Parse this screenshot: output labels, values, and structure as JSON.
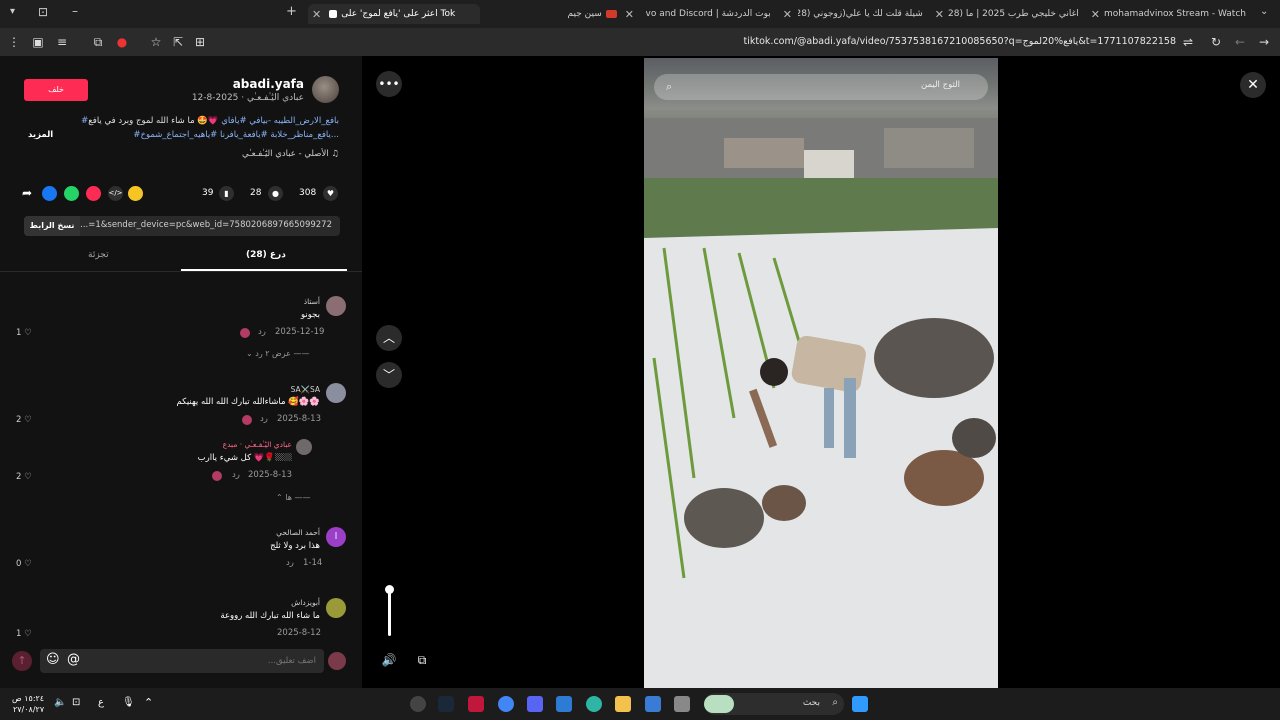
{
  "browser": {
    "tabs": [
      {
        "label": "mohamadvinox Stream - Watch",
        "favicon_color": "#53fc18"
      },
      {
        "label": "(28) اغاني خليجي طرب 2025 | ما",
        "favicon_color": "#ff0033"
      },
      {
        "label": "(28) شيلة قلت لك يا علي(زوجوني",
        "favicon_color": "#ff0033"
      },
      {
        "label": "rovo and Discord | بوت الدردشة",
        "favicon_color": "#ffffff"
      },
      {
        "label": "سين جيم",
        "favicon_color": "#d23a2a"
      },
      {
        "label": "اعثر على 'يافع لموج' على Tok",
        "favicon_color": "#ffffff"
      }
    ],
    "url": "tiktok.com/@abadi.yafa/video/7537538167210085650?q=يافع%20لموج&t=1771107822158"
  },
  "post": {
    "back_label": "خلف",
    "username": "abadi.yafa",
    "subline": "عبادي اليَٰـٰفـعـٰي · 2025-8-12",
    "desc_line1": "ما شاء الله لموج وبرد في يافع",
    "desc_line1_tags": "#بافع_الارض_الطيبه -بيافي #يافاي",
    "desc_line2": "#يافع_مناظر_خلابة #يافعة_يافرنا #ياهيه_اجتماع_شموخ...",
    "more_label": "المزيد",
    "sound": "الأصلي - عبادي اليَٰـٰفـعـٰي",
    "likes": "308",
    "comments": "28",
    "saves": "39",
    "copy_link_label": "نسخ الرابط",
    "link_text": "...=1&sender_device=pc&web_id=7580206897665099272",
    "tab_comments": "درع (28)",
    "tab_creator": "تجزئة"
  },
  "comments": [
    {
      "name": "أستاذ",
      "text": "بجونو",
      "date": "2025-12-19",
      "reply": "رد",
      "likes": "1",
      "view_replies": "عرض ٢ رد"
    },
    {
      "name": "SA⚔️SA",
      "text": "ماشاءالله تبارك الله الله يهنيكم 🥰🌸🌸",
      "date": "2025-8-13",
      "reply": "رد",
      "likes": "2"
    },
    {
      "name": "عبادي اليَٰـٰفـعـٰي · مبدع",
      "text": "كل شيء ياارب 💗🌹🏼🏼",
      "date": "2025-8-13",
      "reply": "رد",
      "likes": "2",
      "hide": "ها"
    },
    {
      "name": "أحمد الصالحي",
      "text": "هذا برد ولا ثلج",
      "date": "1-14",
      "reply": "رد",
      "likes": "0"
    },
    {
      "name": "أبويزداش",
      "text": "ما شاء الله تبارك الله رووعة",
      "date": "2025-8-12",
      "reply": "رد",
      "likes": "1"
    }
  ],
  "comment_input": {
    "placeholder": "...اضف تعليق"
  },
  "video": {
    "search_placeholder": "الثوج اليمن"
  },
  "taskbar": {
    "search_label": "بحث",
    "clock_time": "١٥:٢٤ ص",
    "clock_date": "٢٧/٠٨/٢٧",
    "lang": "ع"
  },
  "colors": {
    "accent": "#fe2c55",
    "hashtag": "#8ab4f8"
  }
}
